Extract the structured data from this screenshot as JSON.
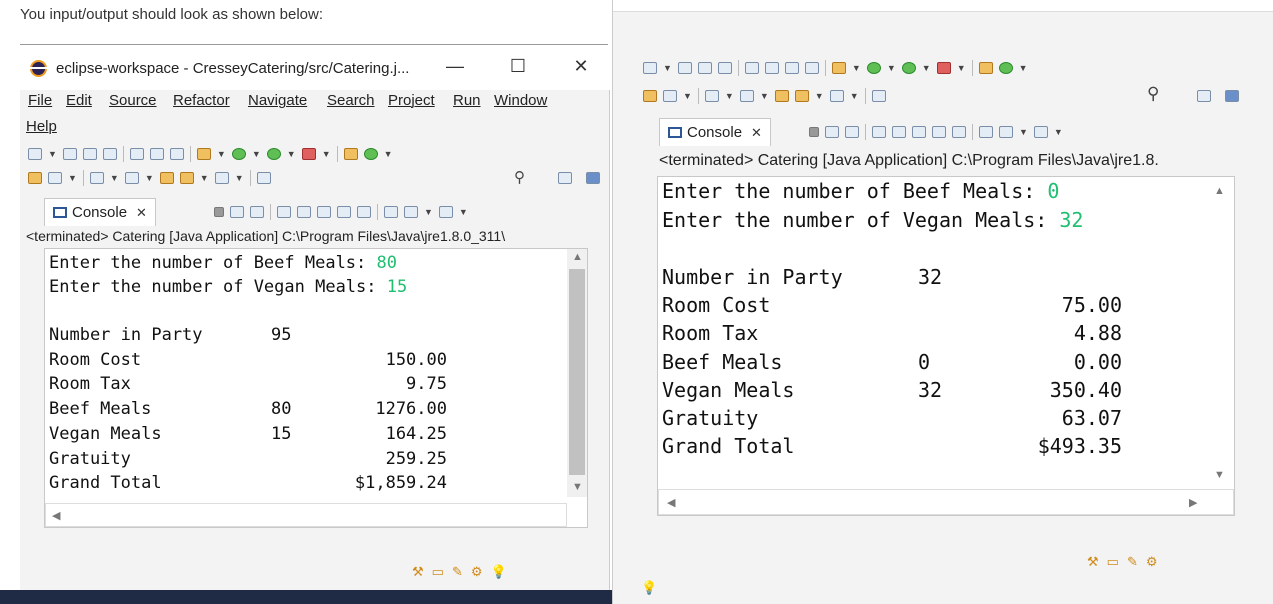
{
  "caption": "You input/output should look as shown below:",
  "left": {
    "title": "eclipse-workspace - CresseyCatering/src/Catering.j...",
    "window_controls": {
      "minimize": "—",
      "maximize": "☐",
      "close": "✕"
    },
    "menu": [
      "File",
      "Edit",
      "Source",
      "Refactor",
      "Navigate",
      "Search",
      "Project",
      "Run",
      "Window",
      "Help"
    ],
    "console_tab": "Console",
    "terminated": "<terminated> Catering [Java Application] C:\\Program Files\\Java\\jre1.8.0_311\\",
    "prompt_beef": "Enter the number of Beef Meals: ",
    "input_beef": "80",
    "prompt_vegan": "Enter the number of Vegan Meals: ",
    "input_vegan": "15",
    "report": [
      {
        "label": "Number in Party",
        "qty": "95",
        "amount": ""
      },
      {
        "label": "Room Cost",
        "qty": "",
        "amount": "150.00"
      },
      {
        "label": "Room Tax",
        "qty": "",
        "amount": "9.75"
      },
      {
        "label": "Beef Meals",
        "qty": "80",
        "amount": "1276.00"
      },
      {
        "label": "Vegan Meals",
        "qty": "15",
        "amount": "164.25"
      },
      {
        "label": "Gratuity",
        "qty": "",
        "amount": "259.25"
      },
      {
        "label": "Grand Total",
        "qty": "",
        "amount": "$1,859.24"
      }
    ]
  },
  "right": {
    "console_tab": "Console",
    "terminated": "<terminated> Catering [Java Application] C:\\Program Files\\Java\\jre1.8.",
    "prompt_beef": "Enter the number of Beef Meals: ",
    "input_beef": "0",
    "prompt_vegan": "Enter the number of Vegan Meals: ",
    "input_vegan": "32",
    "report": [
      {
        "label": "Number in Party",
        "qty": "32",
        "amount": ""
      },
      {
        "label": "Room Cost",
        "qty": "",
        "amount": "75.00"
      },
      {
        "label": "Room Tax",
        "qty": "",
        "amount": "4.88"
      },
      {
        "label": "Beef Meals",
        "qty": "0",
        "amount": "0.00"
      },
      {
        "label": "Vegan Meals",
        "qty": "32",
        "amount": "350.40"
      },
      {
        "label": "Gratuity",
        "qty": "",
        "amount": "63.07"
      },
      {
        "label": "Grand Total",
        "qty": "",
        "amount": "$493.35"
      }
    ]
  },
  "colors": {
    "input_text": "#1fbf6f",
    "console_icon": "#2b5797"
  },
  "icons": [
    "eclipse-logo",
    "console-icon",
    "close-icon",
    "search-icon",
    "lightbulb-icon"
  ]
}
